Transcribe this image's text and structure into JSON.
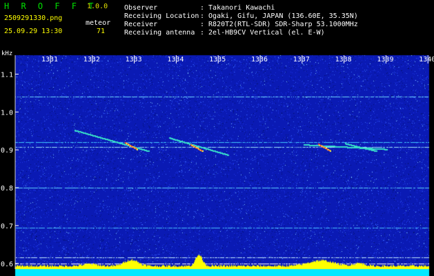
{
  "app": {
    "logo": "H R O F F T",
    "version": "1.0.0"
  },
  "file": {
    "name": "2509291330.png",
    "datetime": "25.09.29 13:30",
    "meteor_label": "meteor",
    "meteor_count": "71"
  },
  "info": {
    "observer_label": "Observer",
    "observer_value": ": Takanori Kawachi",
    "location_label": "Receiving Location",
    "location_value": ": Ogaki, Gifu, JAPAN (136.60E, 35.35N)",
    "receiver_label": "Receiver",
    "receiver_value": ": R820T2(RTL-SDR) SDR-Sharp 53.1000MHz",
    "antenna_label": "Receiving antenna",
    "antenna_value": ": 2el-HB9CV Vertical (el. E-W)"
  },
  "axis": {
    "unit": "kHz",
    "y_ticks": [
      "1.1",
      "1.0",
      "0.9",
      "0.8",
      "0.7",
      "0.6"
    ],
    "x_ticks": [
      "1331",
      "1332",
      "1333",
      "1334",
      "1335",
      "1336",
      "1337",
      "1338",
      "1339",
      "1340"
    ]
  },
  "colors": {
    "background": "#000000",
    "spectrum": "#0a1ab4",
    "level": "#ffff00",
    "tone": "#00ffff",
    "grid": "#8fd0ff"
  }
}
